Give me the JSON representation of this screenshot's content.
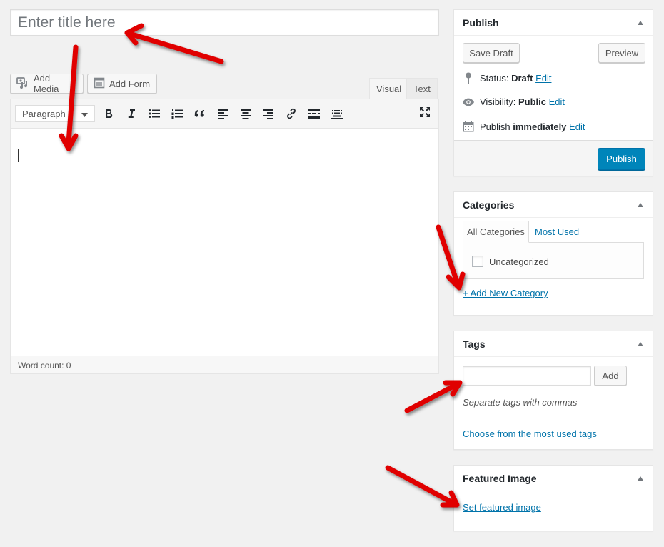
{
  "title": {
    "placeholder": "Enter title here",
    "value": ""
  },
  "media_buttons": {
    "add_media": "Add Media",
    "add_form": "Add Form"
  },
  "editor_tabs": {
    "visual": "Visual",
    "text": "Text"
  },
  "toolbar": {
    "format_value": "Paragraph"
  },
  "status_bar": {
    "word_count": "Word count: 0"
  },
  "publish": {
    "title": "Publish",
    "save_draft": "Save Draft",
    "preview": "Preview",
    "status_label": "Status:",
    "status_value": "Draft",
    "visibility_label": "Visibility:",
    "visibility_value": "Public",
    "publish_label": "Publish",
    "publish_value": "immediately",
    "edit": "Edit",
    "publish_button": "Publish"
  },
  "categories": {
    "title": "Categories",
    "tab_all": "All Categories",
    "tab_most_used": "Most Used",
    "items": [
      {
        "label": "Uncategorized",
        "checked": false
      }
    ],
    "add_new": "+ Add New Category"
  },
  "tags": {
    "title": "Tags",
    "input_value": "",
    "add_button": "Add",
    "hint": "Separate tags with commas",
    "choose_link": "Choose from the most used tags"
  },
  "featured_image": {
    "title": "Featured Image",
    "set_link": "Set featured image"
  },
  "colors": {
    "primary": "#0085ba",
    "link": "#0073aa",
    "arrow": "#e00000",
    "background": "#f1f1f1"
  },
  "icons": {
    "add_media": "media-icon",
    "add_form": "form-icon",
    "bold": "bold-icon",
    "italic": "italic-icon",
    "bullet_list": "bullet-list-icon",
    "numbered_list": "numbered-list-icon",
    "blockquote": "blockquote-icon",
    "align_left": "align-left-icon",
    "align_center": "align-center-icon",
    "align_right": "align-right-icon",
    "link": "link-icon",
    "read_more": "read-more-icon",
    "toolbar_toggle": "toolbar-toggle-icon",
    "fullscreen": "fullscreen-icon",
    "status": "pin-icon",
    "visibility": "eye-icon",
    "schedule": "calendar-icon",
    "toggle": "caret-up-icon"
  }
}
